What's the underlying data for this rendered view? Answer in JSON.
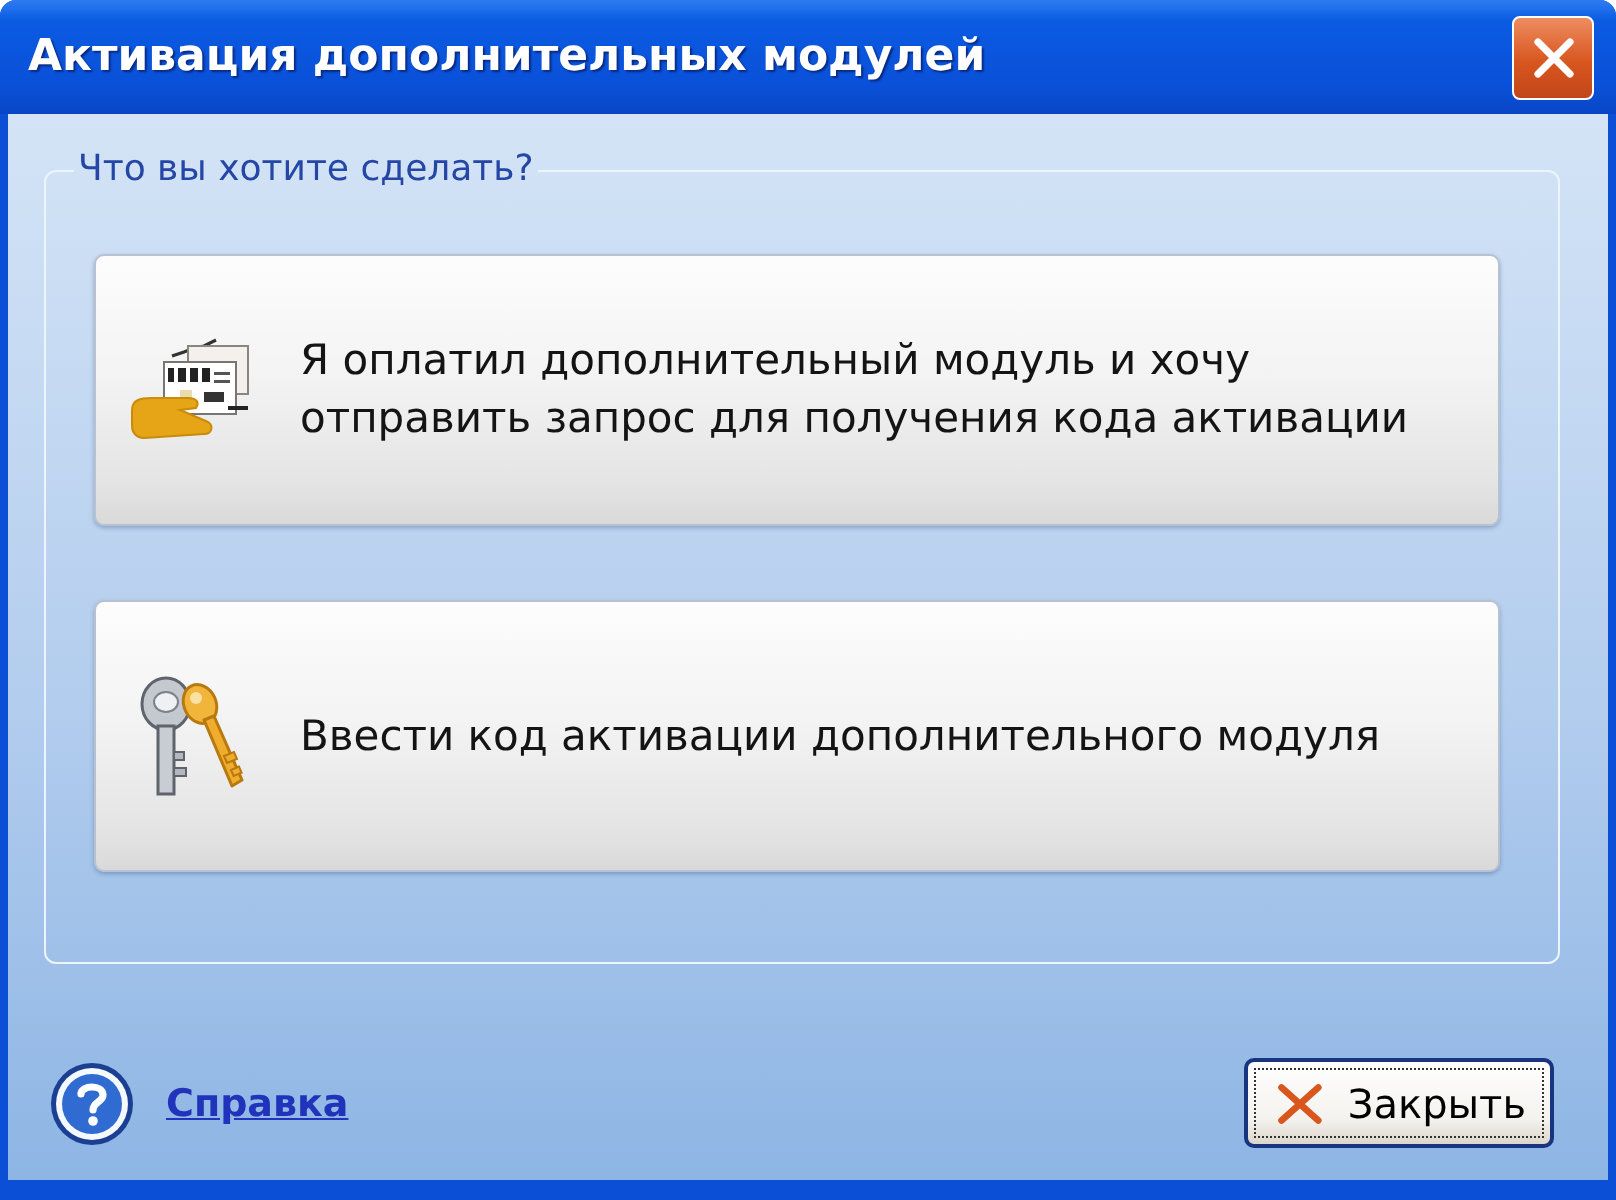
{
  "window": {
    "title": "Активация дополнительных модулей"
  },
  "group": {
    "legend": "Что вы хотите сделать?"
  },
  "options": [
    {
      "kind": "payment",
      "text": "Я оплатил дополнительный модуль и хочу\nотправить запрос для получения кода активации"
    },
    {
      "kind": "keys",
      "text": "Ввести код активации дополнительного модуля"
    }
  ],
  "help_link": "Справка",
  "buttons": [
    {
      "label": "Закрыть",
      "focused": true
    }
  ]
}
